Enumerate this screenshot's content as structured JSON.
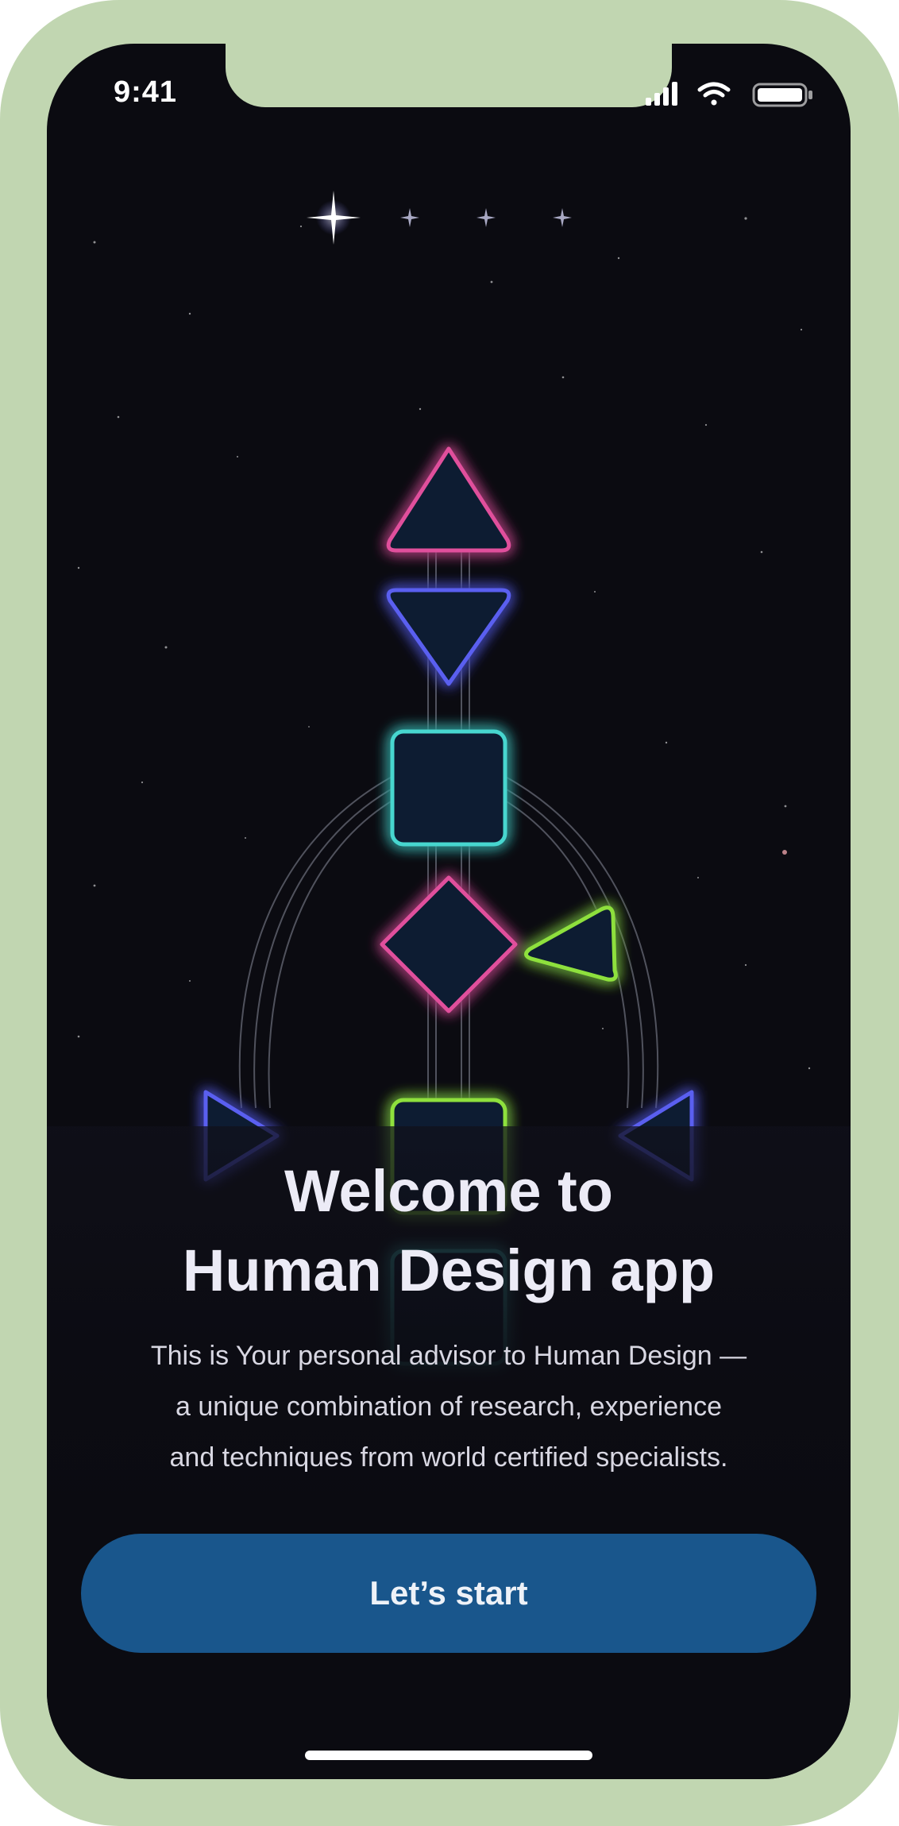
{
  "status_bar": {
    "time": "9:41",
    "icons": [
      "cellular-signal-icon",
      "wifi-icon",
      "battery-icon"
    ]
  },
  "hero": {
    "illustration": "bodygraph-illustration",
    "colors": {
      "pink_glow": "#e0509c",
      "blue_glow": "#5a5ff0",
      "teal_glow": "#46d6cf",
      "green_glow": "#8ee03d",
      "shape_fill": "#0b1d30"
    }
  },
  "welcome": {
    "title_line1": "Welcome to",
    "title_line2": "Human Design app",
    "description_line1": "This is Your personal advisor to Human Design —",
    "description_line2": "a unique combination of research, experience",
    "description_line3": "and techniques from world certified specialists."
  },
  "actions": {
    "start_label": "Let’s start",
    "button_color": "#19568c"
  }
}
